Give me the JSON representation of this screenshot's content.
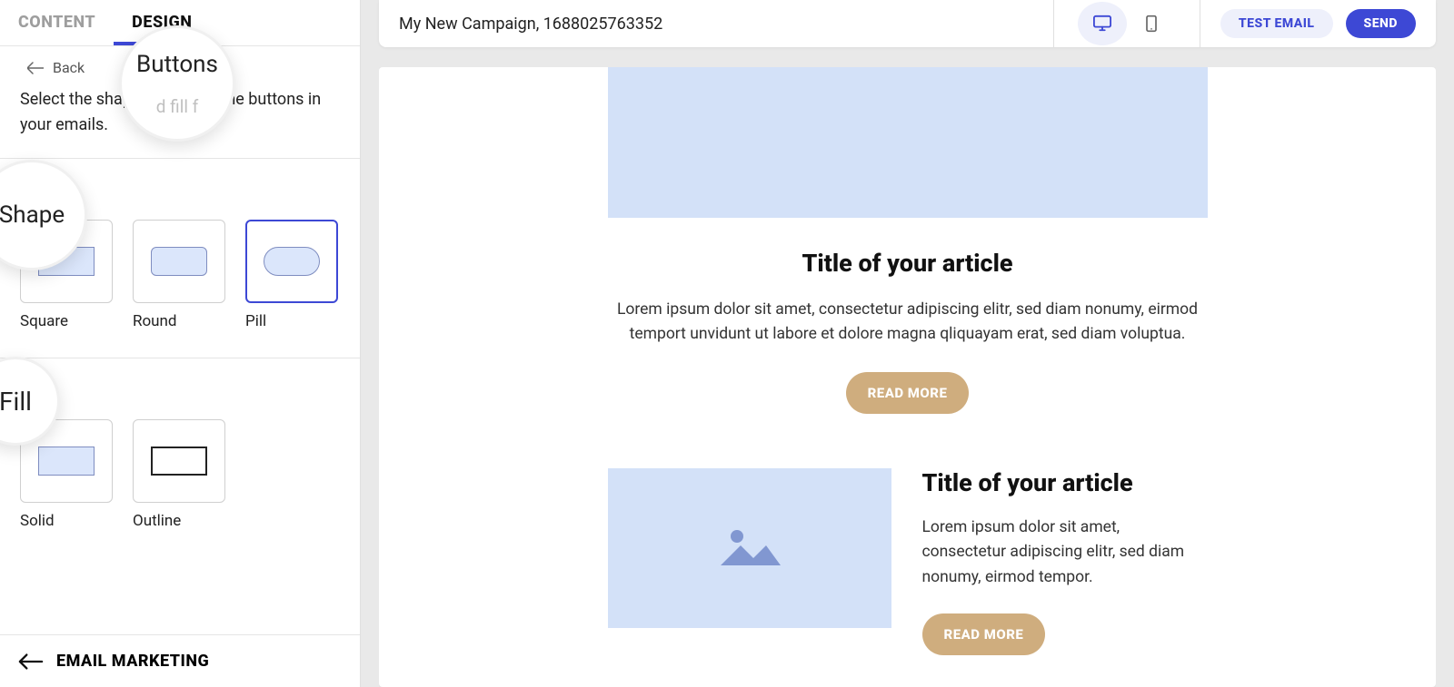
{
  "tabs": {
    "content": "CONTENT",
    "design": "DESIGN"
  },
  "back": "Back",
  "help_text": "Select the shape and fill for the buttons in your emails.",
  "zoom": {
    "buttons_main": "Buttons",
    "buttons_sub": "d fill f",
    "shape": "Shape",
    "fill": "Fill"
  },
  "shape": {
    "title": "Shape",
    "options": {
      "square": "Square",
      "round": "Round",
      "pill": "Pill"
    },
    "selected": "pill"
  },
  "fill": {
    "title": "Fill",
    "options": {
      "solid": "Solid",
      "outline": "Outline"
    },
    "selected": "solid"
  },
  "footer": "EMAIL MARKETING",
  "topbar": {
    "campaign_name": "My New Campaign, 1688025763352",
    "test_email": "TEST EMAIL",
    "send": "SEND"
  },
  "preview": {
    "article1": {
      "title": "Title of your article",
      "body": "Lorem ipsum dolor sit amet, consectetur adipiscing elitr, sed diam nonumy, eirmod temport unvidunt ut labore et dolore magna qliquayam erat, sed diam voluptua.",
      "cta": "READ MORE"
    },
    "article2": {
      "title": "Title of your article",
      "body": "Lorem ipsum dolor sit amet, consectetur adipiscing elitr, sed diam nonumy, eirmod tempor.",
      "cta": "READ MORE"
    }
  }
}
